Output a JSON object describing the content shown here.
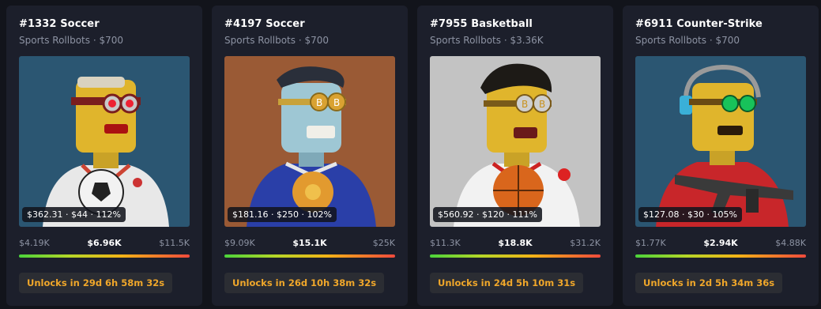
{
  "cards": [
    {
      "title": "#1332 Soccer",
      "subtitle": "Sports Rollbots · $700",
      "stats": "$362.31 · $44 · 112%",
      "price_low": "$4.19K",
      "price_mid": "$6.96K",
      "price_high": "$11.5K",
      "unlock": "Unlocks in 29d 6h 58m 32s",
      "bg": "#2b5672"
    },
    {
      "title": "#4197 Soccer",
      "subtitle": "Sports Rollbots · $700",
      "stats": "$181.16 · $250 · 102%",
      "price_low": "$9.09K",
      "price_mid": "$15.1K",
      "price_high": "$25K",
      "unlock": "Unlocks in 26d 10h 38m 32s",
      "bg": "#9a5a35"
    },
    {
      "title": "#7955 Basketball",
      "subtitle": "Sports Rollbots · $3.36K",
      "stats": "$560.92 · $120 · 111%",
      "price_low": "$11.3K",
      "price_mid": "$18.8K",
      "price_high": "$31.2K",
      "unlock": "Unlocks in 24d 5h 10m 31s",
      "bg": "#c3c3c3"
    },
    {
      "title": "#6911 Counter-Strike",
      "subtitle": "Sports Rollbots · $700",
      "stats": "$127.08 · $30 · 105%",
      "price_low": "$1.77K",
      "price_mid": "$2.94K",
      "price_high": "$4.88K",
      "unlock": "Unlocks in 2d 5h 34m 36s",
      "bg": "#2b5672"
    }
  ]
}
